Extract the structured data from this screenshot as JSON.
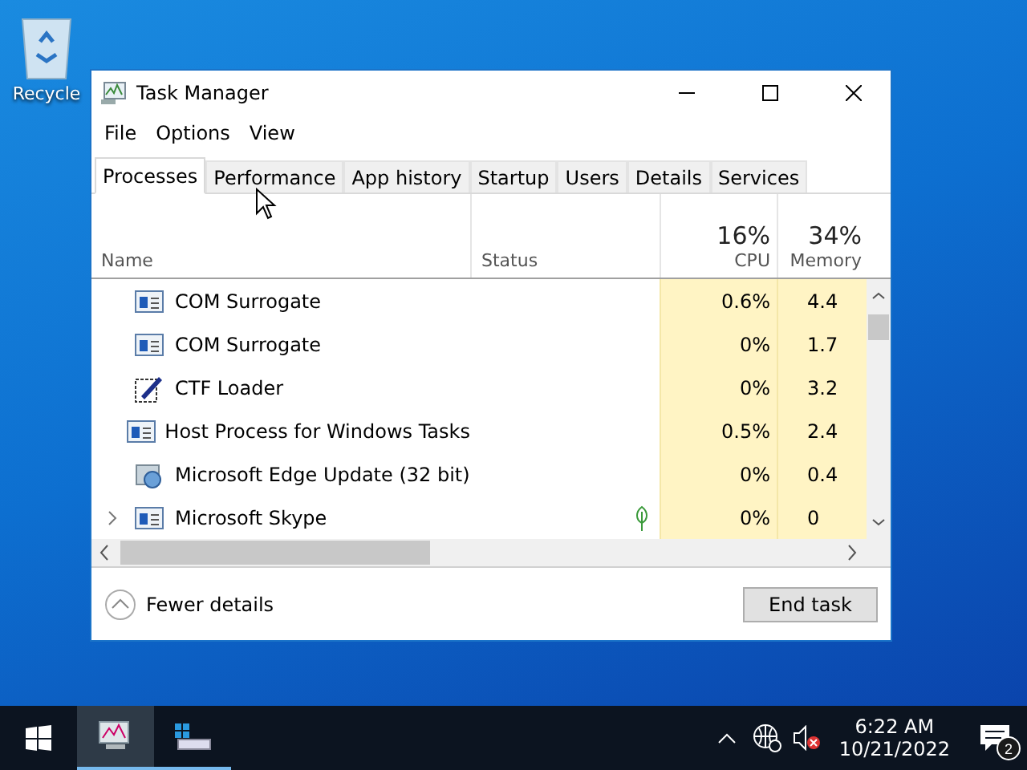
{
  "desktop": {
    "icons": [
      {
        "label": "Recycle"
      }
    ]
  },
  "window": {
    "title": "Task Manager",
    "menu": [
      "File",
      "Options",
      "View"
    ],
    "tabs": [
      {
        "label": "Processes",
        "selected": true
      },
      {
        "label": "Performance",
        "selected": false
      },
      {
        "label": "App history",
        "selected": false
      },
      {
        "label": "Startup",
        "selected": false
      },
      {
        "label": "Users",
        "selected": false
      },
      {
        "label": "Details",
        "selected": false
      },
      {
        "label": "Services",
        "selected": false
      }
    ],
    "table": {
      "columns": [
        {
          "label": "Name"
        },
        {
          "label": "Status"
        },
        {
          "label": "CPU",
          "summary": "16%"
        },
        {
          "label": "Memory",
          "summary": "34%"
        }
      ],
      "rows": [
        {
          "kind": "window",
          "name": "COM Surrogate",
          "expandable": false,
          "suspended": false,
          "cpu": "0.6%",
          "memory": "4.4"
        },
        {
          "kind": "window",
          "name": "COM Surrogate",
          "expandable": false,
          "suspended": false,
          "cpu": "0%",
          "memory": "1.7"
        },
        {
          "kind": "pen",
          "name": "CTF Loader",
          "expandable": false,
          "suspended": false,
          "cpu": "0%",
          "memory": "3.2"
        },
        {
          "kind": "window",
          "name": "Host Process for Windows Tasks",
          "expandable": false,
          "suspended": false,
          "cpu": "0.5%",
          "memory": "2.4"
        },
        {
          "kind": "update",
          "name": "Microsoft Edge Update (32 bit)",
          "expandable": false,
          "suspended": false,
          "cpu": "0%",
          "memory": "0.4"
        },
        {
          "kind": "window",
          "name": "Microsoft Skype",
          "expandable": true,
          "suspended": true,
          "cpu": "0%",
          "memory": "0"
        }
      ]
    },
    "footer": {
      "toggle": "Fewer details",
      "button": "End task"
    }
  },
  "taskbar": {
    "time": "6:22 AM",
    "date": "10/21/2022",
    "notifications": "2"
  }
}
